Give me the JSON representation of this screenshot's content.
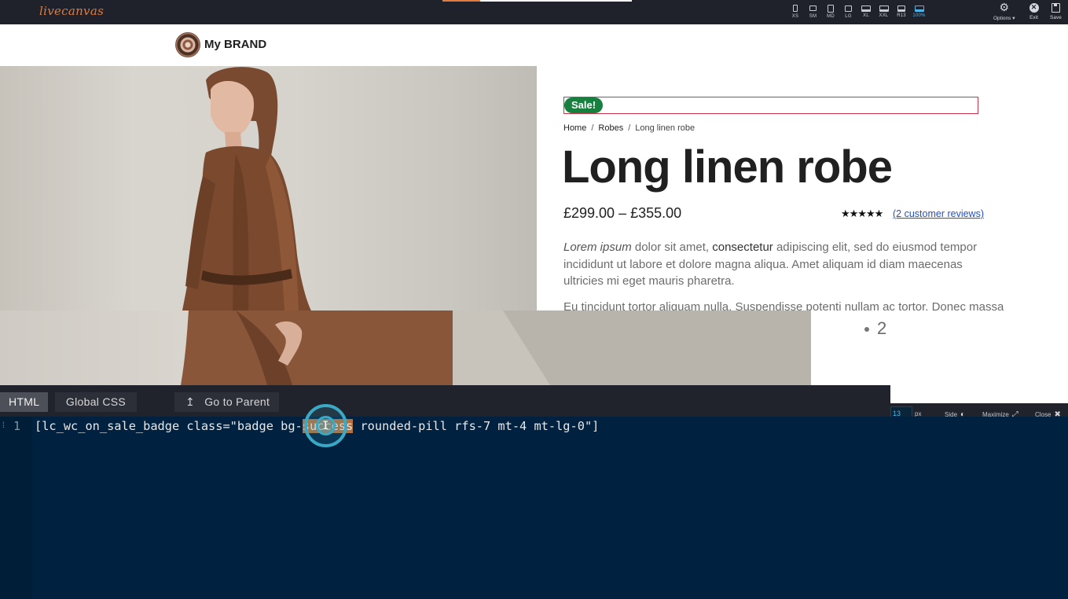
{
  "app": {
    "logo": "livecanvas",
    "devices": [
      {
        "label": "XS",
        "icon": "phone-icon"
      },
      {
        "label": "SM",
        "icon": "phone-landscape-icon"
      },
      {
        "label": "MD",
        "icon": "tablet-icon"
      },
      {
        "label": "LG",
        "icon": "tablet-landscape-icon"
      },
      {
        "label": "XL",
        "icon": "desktop-icon"
      },
      {
        "label": "XXL",
        "icon": "wide-desktop-icon"
      },
      {
        "label": "R13",
        "icon": "laptop-icon"
      },
      {
        "label": "100%",
        "icon": "fullwidth-icon"
      }
    ],
    "active_device": "100%",
    "options_label": "Options ▾",
    "exit_label": "Exit",
    "save_label": "Save",
    "accent_color": "#4fb4e8",
    "brand_color": "#e07a3f"
  },
  "site": {
    "brand_name": "My BRAND"
  },
  "product": {
    "sale_badge": "Sale!",
    "breadcrumb": [
      "Home",
      "Robes",
      "Long linen robe"
    ],
    "breadcrumb_separator": "/",
    "title": "Long linen robe",
    "price": "£299.00 – £355.00",
    "stars": "★★★★★",
    "rating": 5,
    "reviews_link": "(2 customer reviews)",
    "description": {
      "italic": "Lorem ipsum",
      "part1": " dolor sit amet, ",
      "emphasis": "consectetur",
      "part2": " adipiscing elit, sed do eiusmod tempor incididunt ut labore et dolore magna aliqua. Amet aliquam id diam maecenas ultricies mi eget mauris pharetra."
    },
    "description2": "Eu tincidunt tortor aliquam nulla. Suspendisse potenti nullam ac tortor. Donec massa",
    "gallery_pager": "2",
    "sale_color": "#18803f"
  },
  "editor": {
    "tabs": [
      "HTML",
      "Global CSS"
    ],
    "active_tab": "HTML",
    "parent_button": "Go to Parent",
    "parent_icon": "↥",
    "font_size": "13",
    "font_unit": "px",
    "side_label": "Side",
    "maximize_label": "Maximize",
    "close_label": "Close",
    "line_number": "1",
    "code_before": "[lc_wc_on_sale_badge class=\"badge bg-",
    "code_selected": "success",
    "code_after": " rounded-pill rfs-7 mt-4 mt-lg-0\"]",
    "background_color": "#002240",
    "selection_color": "#b46f3a"
  }
}
